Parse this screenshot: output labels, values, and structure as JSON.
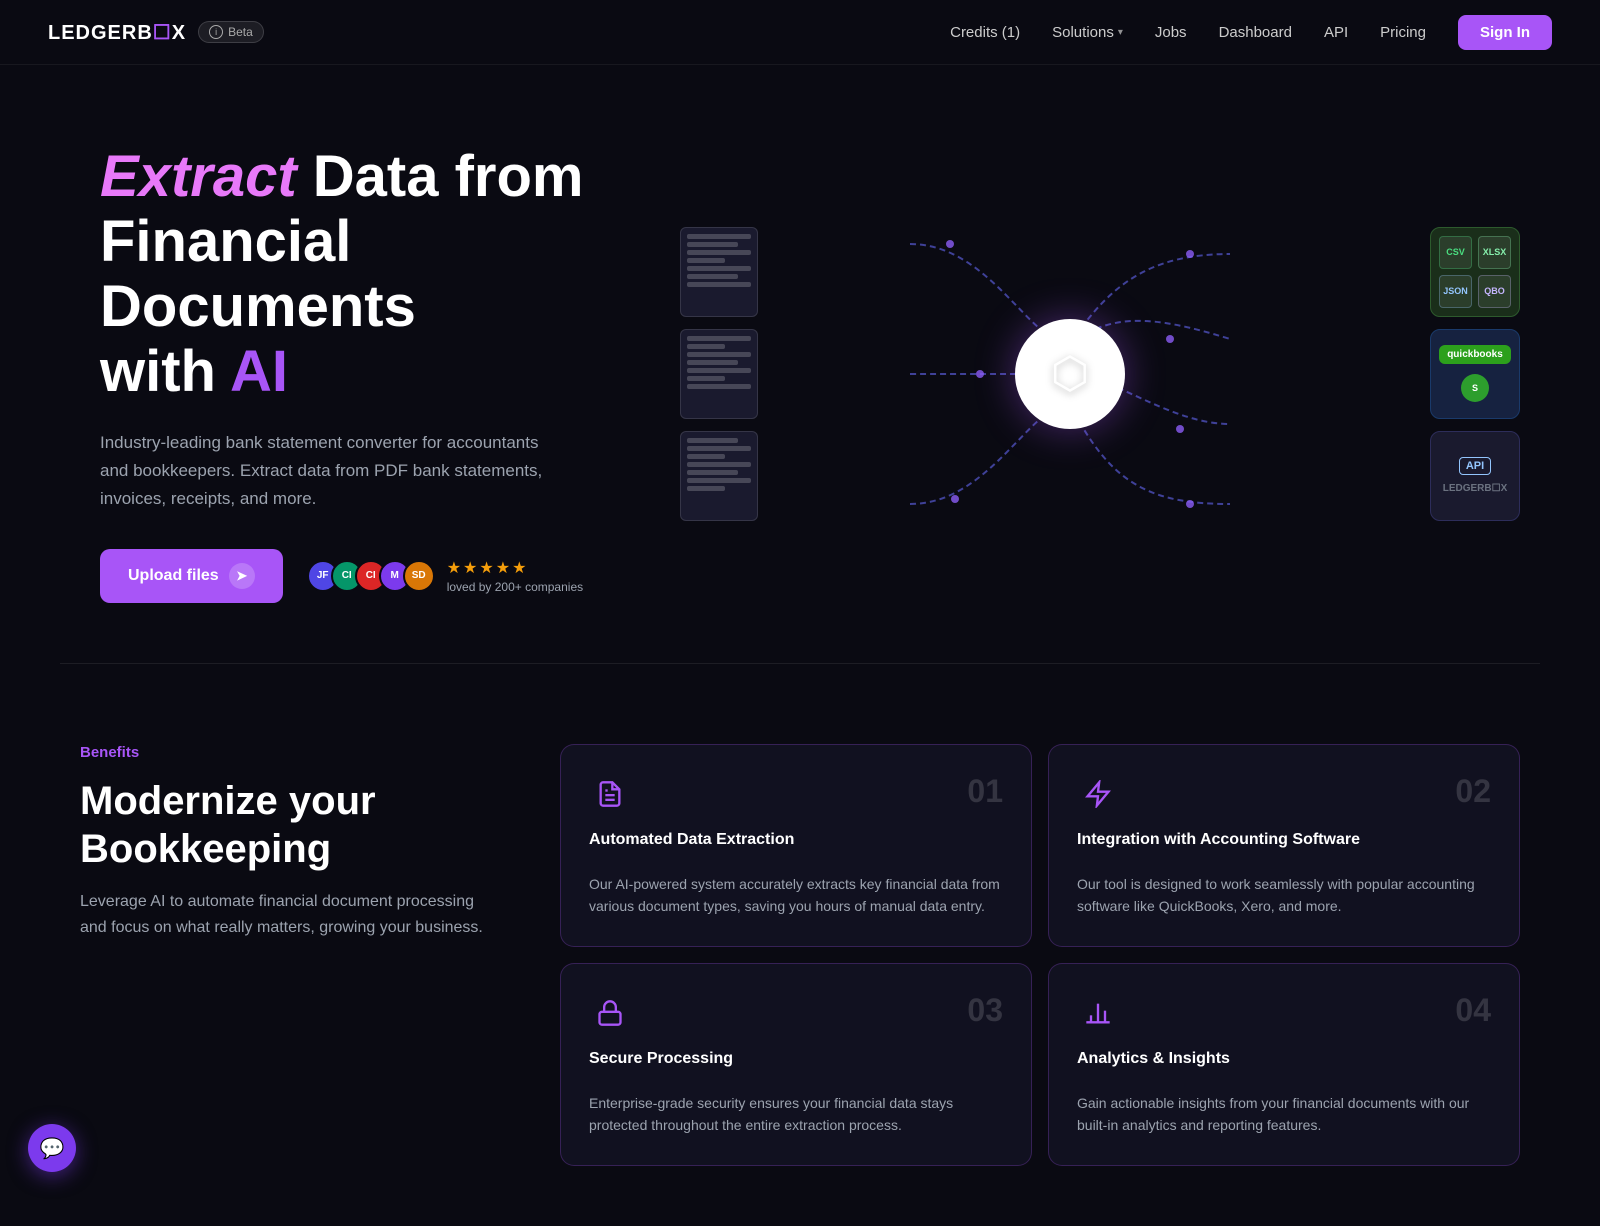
{
  "brand": {
    "name_part1": "LEDGERB",
    "name_part2": "X",
    "beta_label": "Beta"
  },
  "nav": {
    "credits_label": "Credits (1)",
    "solutions_label": "Solutions",
    "jobs_label": "Jobs",
    "dashboard_label": "Dashboard",
    "api_label": "API",
    "pricing_label": "Pricing",
    "signin_label": "Sign In"
  },
  "hero": {
    "title_extract": "Extract",
    "title_rest1": " Data from",
    "title_line2": "Financial Documents",
    "title_line3_pre": "with ",
    "title_ai": "AI",
    "description": "Industry-leading bank statement converter for accountants and bookkeepers. Extract data from PDF bank statements, invoices, receipts, and more.",
    "upload_label": "Upload files",
    "stars": "★★★★★",
    "loved_text": "loved by 200+ companies",
    "avatars": [
      "JF",
      "CI",
      "CI",
      "M",
      "SD"
    ]
  },
  "benefits": {
    "tag": "Benefits",
    "title": "Modernize your Bookkeeping",
    "description": "Leverage AI to automate financial document processing and focus on what really matters, growing your business.",
    "cards": [
      {
        "num": "01",
        "title": "Automated Data Extraction",
        "description": "Our AI-powered system accurately extracts key financial data from various document types, saving you hours of manual data entry.",
        "icon": "📄"
      },
      {
        "num": "02",
        "title": "Integration with Accounting Software",
        "description": "Our tool is designed to work seamlessly with popular accounting software like QuickBooks, Xero, and more.",
        "icon": "⚡"
      },
      {
        "num": "03",
        "title": "Secure Processing",
        "description": "Enterprise-grade security ensures your financial data stays protected throughout the entire extraction process.",
        "icon": "🔒"
      },
      {
        "num": "04",
        "title": "Analytics & Insights",
        "description": "Gain actionable insights from your financial documents with our built-in analytics and reporting features.",
        "icon": "📈"
      }
    ]
  },
  "chat": {
    "icon": "💬"
  }
}
